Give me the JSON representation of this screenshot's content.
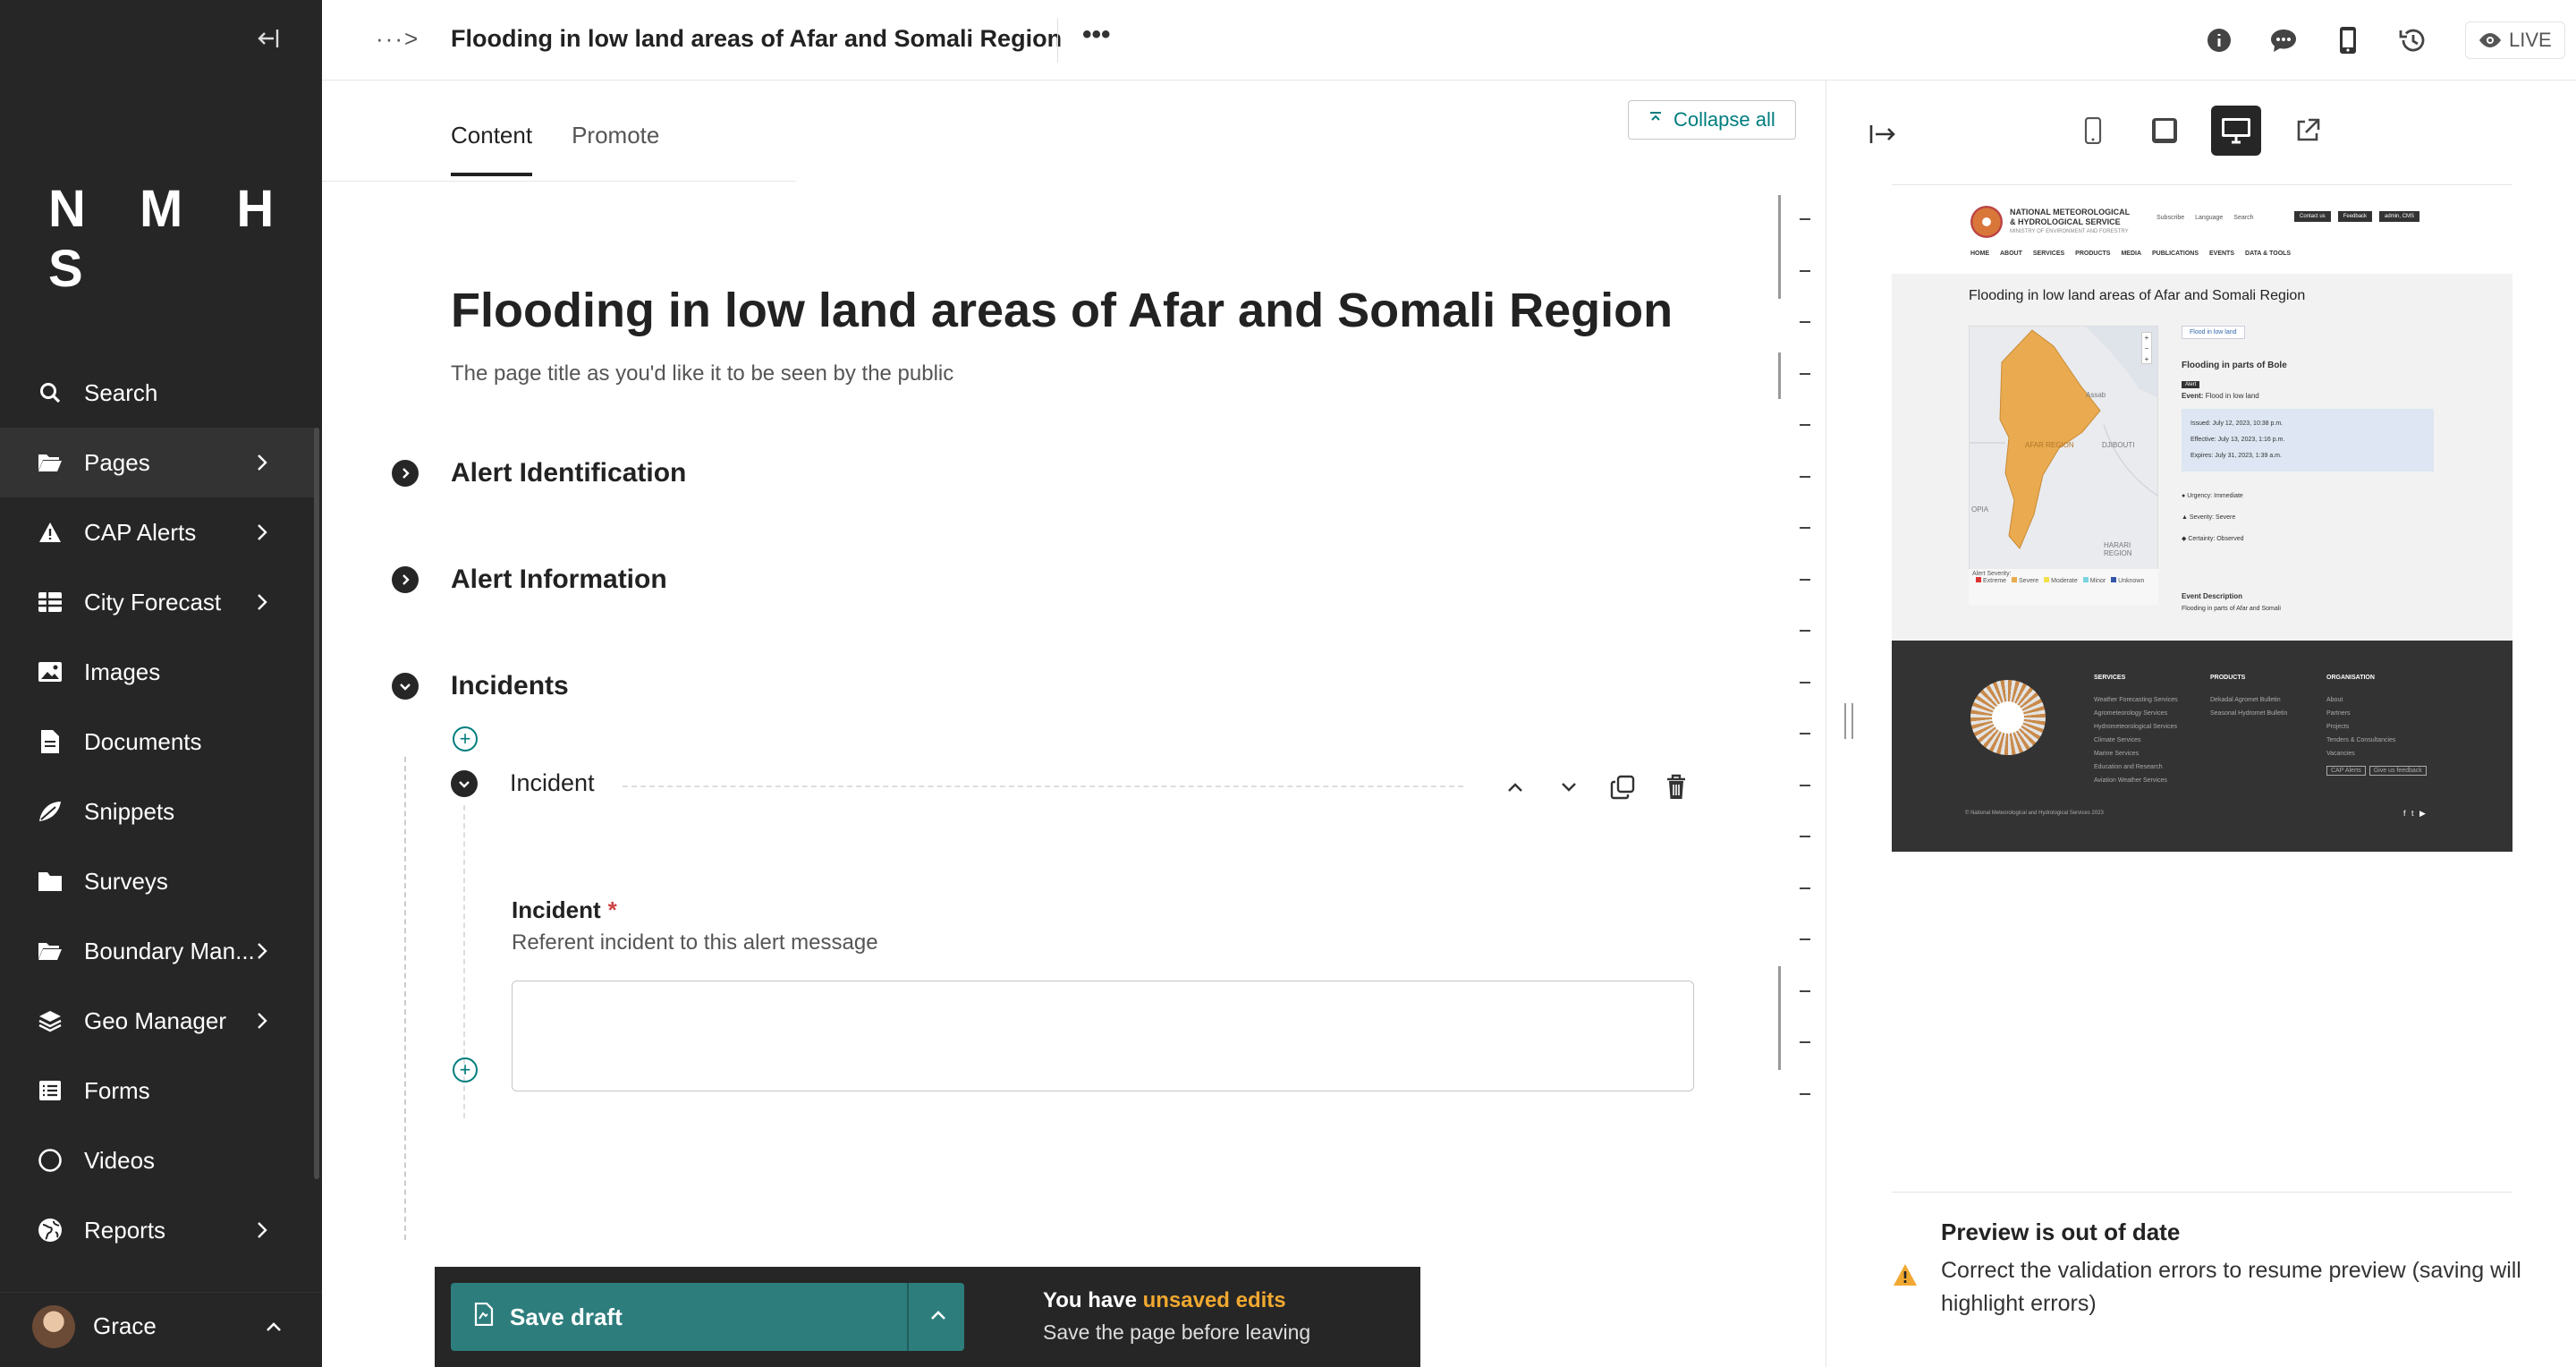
{
  "sidebar": {
    "logo": "N M H S",
    "items": [
      {
        "label": "Search",
        "icon": "search-icon"
      },
      {
        "label": "Pages",
        "icon": "folder-open-icon"
      },
      {
        "label": "CAP Alerts",
        "icon": "warning-icon"
      },
      {
        "label": "City Forecast",
        "icon": "table-icon"
      },
      {
        "label": "Images",
        "icon": "image-icon"
      },
      {
        "label": "Documents",
        "icon": "document-icon"
      },
      {
        "label": "Snippets",
        "icon": "snippet-icon"
      },
      {
        "label": "Surveys",
        "icon": "folder-icon"
      },
      {
        "label": "Boundary Man...",
        "icon": "folder-open-icon"
      },
      {
        "label": "Geo Manager",
        "icon": "layers-icon"
      },
      {
        "label": "Forms",
        "icon": "list-icon"
      },
      {
        "label": "Videos",
        "icon": "circle-icon"
      },
      {
        "label": "Reports",
        "icon": "globe-icon"
      }
    ],
    "user": "Grace"
  },
  "header": {
    "breadcrumb": "···>",
    "title": "Flooding in low land areas of Afar and Somali Region",
    "more": "•••",
    "live_label": "LIVE"
  },
  "editor": {
    "tabs": [
      "Content",
      "Promote"
    ],
    "collapse_all": "Collapse all",
    "page_title": "Flooding in low land areas of Afar and Somali Region",
    "page_title_help": "The page title as you'd like it to be seen by the public",
    "sections": [
      "Alert Identification",
      "Alert Information",
      "Incidents"
    ],
    "incident_block": {
      "name": "Incident",
      "field_label": "Incident",
      "required_mark": "*",
      "field_help": "Referent incident to this alert message",
      "field_value": ""
    }
  },
  "savebar": {
    "save_label": "Save draft",
    "msg_prefix": "You have ",
    "msg_highlight": "unsaved edits",
    "msg_sub": "Save the page before leaving"
  },
  "preview": {
    "site": {
      "org_line1": "NATIONAL METEOROLOGICAL",
      "org_line2": "& HYDROLOGICAL SERVICE",
      "org_line3": "MINISTRY OF ENVIRONMENT AND FORESTRY",
      "util": [
        "Subscribe",
        "Language",
        "Search"
      ],
      "btns": [
        "Contact us",
        "Feedback",
        "admin, CMS"
      ],
      "nav": [
        "HOME",
        "ABOUT",
        "SERVICES",
        "PRODUCTS",
        "MEDIA",
        "PUBLICATIONS",
        "EVENTS",
        "DATA & TOOLS"
      ],
      "alert_title": "Flooding in low land areas of Afar and Somali Region",
      "map_labels": [
        "AFAR REGION",
        "DJIBOUTI",
        "HARARI REGION",
        "OPIA",
        "Assab"
      ],
      "legend_title": "Alert Severity:",
      "legend": [
        "Extreme",
        "Severe",
        "Moderate",
        "Minor",
        "Unknown"
      ],
      "pill": "Flood in low land",
      "card_title": "Flooding in parts of Bole",
      "tag": "Alert",
      "event_label": "Event:",
      "event_value": "Flood in low land",
      "issued": "Issued: July 12, 2023, 10:38 p.m.",
      "effective": "Effective: July 13, 2023, 1:16 p.m.",
      "expires": "Expires: July 31, 2023, 1:39 a.m.",
      "urgency": "Urgency: Immediate",
      "severity": "Severity: Severe",
      "certainty": "Certainty: Observed",
      "desc_title": "Event Description",
      "desc_text": "Flooding in parts of Afar and Somali",
      "footer_cols": [
        {
          "title": "SERVICES",
          "items": [
            "Weather Forecasting Services",
            "Agrometeorology Services",
            "Hydrometeorological Services",
            "Climate Services",
            "Marine Services",
            "Education and Research",
            "Aviation Weather Services"
          ]
        },
        {
          "title": "PRODUCTS",
          "items": [
            "Dekadal Agromet Bulletin",
            "Seasonal Hydromet Bulletin"
          ]
        },
        {
          "title": "ORGANISATION",
          "items": [
            "About",
            "Partners",
            "Projects",
            "Tenders & Consultancies",
            "Vacancies"
          ]
        }
      ],
      "footer_btns": [
        "CAP Alerts",
        "Give us feedback"
      ],
      "copyright": "© National Meteorological and Hydrological Services 2023"
    },
    "warning_title": "Preview is out of date",
    "warning_text": "Correct the validation errors to resume preview (saving will highlight errors)"
  },
  "colors": {
    "sidebar_bg": "#262626",
    "accent": "#007d7e",
    "save_bg": "#2e7d7d",
    "warning": "#f0a830",
    "map_region": "#eaaa4f"
  }
}
